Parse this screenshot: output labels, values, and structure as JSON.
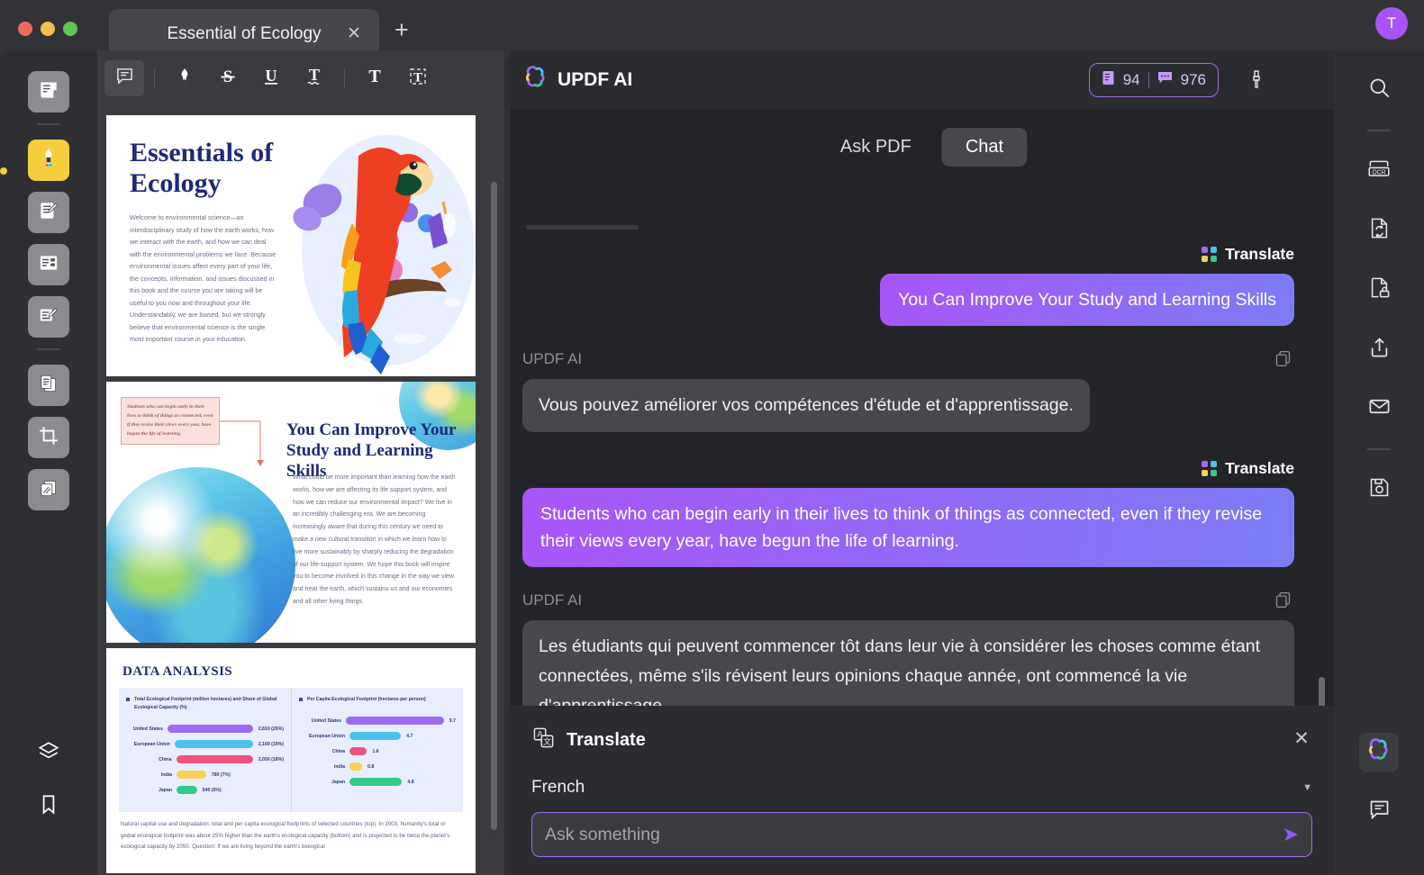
{
  "window": {
    "tab_title": "Essential of Ecology",
    "close_icon": "close-icon",
    "new_tab_icon": "plus-icon",
    "avatar_initial": "T"
  },
  "doc_toolbar": {
    "items": [
      {
        "name": "comment-tool",
        "icon": "comment-icon",
        "selected": true
      },
      {
        "name": "highlight-tool",
        "icon": "highlighter-icon",
        "selected": false
      },
      {
        "name": "strikethrough-tool",
        "icon": "strikethrough-icon",
        "selected": false
      },
      {
        "name": "underline-tool",
        "icon": "underline-icon",
        "selected": false
      },
      {
        "name": "squiggly-tool",
        "icon": "squiggly-underline-icon",
        "selected": false
      },
      {
        "name": "text-tool",
        "icon": "text-icon",
        "selected": false
      },
      {
        "name": "textbox-tool",
        "icon": "text-box-icon",
        "selected": false
      }
    ]
  },
  "left_rail": {
    "items": [
      {
        "name": "sidebar-item-reader",
        "icon": "book-reader-icon",
        "active": false
      },
      {
        "name": "sidebar-item-highlighter",
        "icon": "highlighter-icon",
        "active": true
      },
      {
        "name": "sidebar-item-edit",
        "icon": "edit-document-icon",
        "active": false
      },
      {
        "name": "sidebar-item-forms",
        "icon": "form-fields-icon",
        "active": false
      },
      {
        "name": "sidebar-item-sign",
        "icon": "signature-icon",
        "active": false
      },
      {
        "name": "sidebar-item-organize",
        "icon": "organize-pages-icon",
        "active": false
      },
      {
        "name": "sidebar-item-crop",
        "icon": "crop-icon",
        "active": false
      },
      {
        "name": "sidebar-item-compare",
        "icon": "compare-documents-icon",
        "active": false
      }
    ],
    "bottom": [
      {
        "name": "sidebar-item-layers",
        "icon": "layers-icon"
      },
      {
        "name": "sidebar-item-bookmarks",
        "icon": "bookmark-icon"
      }
    ]
  },
  "right_rail": {
    "items": [
      {
        "name": "search-button",
        "icon": "search-icon"
      },
      {
        "name": "ocr-button",
        "icon": "ocr-icon"
      },
      {
        "name": "convert-button",
        "icon": "convert-file-icon"
      },
      {
        "name": "protect-button",
        "icon": "document-lock-icon"
      },
      {
        "name": "share-button",
        "icon": "share-icon"
      },
      {
        "name": "email-button",
        "icon": "mail-icon"
      },
      {
        "name": "save-button",
        "icon": "floppy-save-icon"
      }
    ],
    "bottom": [
      {
        "name": "updf-ai-button",
        "icon": "updf-ai-logo-icon",
        "active": true
      },
      {
        "name": "comments-button",
        "icon": "comment-icon",
        "active": false
      }
    ]
  },
  "ai": {
    "title": "UPDF AI",
    "logo_icon": "updf-ai-logo-icon",
    "badge": {
      "pages_icon": "document-pages-icon",
      "pages_count": "94",
      "chats_icon": "chat-bubble-icon",
      "chats_count": "976"
    },
    "brush_icon": "brush-icon",
    "tabs": [
      {
        "label": "Ask PDF",
        "active": false
      },
      {
        "label": "Chat",
        "active": true
      }
    ],
    "messages": [
      {
        "action_label": "Translate",
        "action_icon": "translate-dots-icon",
        "user_text": "You Can Improve Your Study and Learning Skills",
        "assistant_name": "UPDF AI",
        "copy_icon": "copy-icon",
        "assistant_text": "Vous pouvez améliorer vos compétences d'étude et d'apprentissage."
      },
      {
        "action_label": "Translate",
        "action_icon": "translate-dots-icon",
        "user_text": "Students who can begin early in their lives to think of things as connected, even if they revise their views every year, have begun the life of learning.",
        "assistant_name": "UPDF AI",
        "copy_icon": "copy-icon",
        "assistant_text": "Les étudiants qui peuvent commencer tôt dans leur vie à considérer les choses comme étant connectées, même s'ils révisent leurs opinions chaque année, ont commencé la vie d'apprentissage."
      }
    ],
    "composer": {
      "mode_icon": "translate-language-icon",
      "mode_label": "Translate",
      "close_icon": "close-icon",
      "language_value": "French",
      "language_caret_icon": "chevron-down-icon",
      "input_placeholder": "Ask something",
      "input_value": "",
      "send_icon": "send-icon"
    }
  },
  "pdf": {
    "page1": {
      "title": "Essentials\nof Ecology",
      "body": "Welcome to environmental science—an interdisciplinary study of how the earth works, how we interact with the earth, and how we can deal with the environmental problems we face. Because environmental issues affect every part of your life, the concepts, information, and issues discussed in this book and the course you are taking will be useful to you now and throughout your life. Understandably, we are biased, but we strongly believe that environmental science is the single most important course in your education.",
      "artwork": "macaw-parrot-illustration"
    },
    "page2": {
      "note": "Students who can begin early in their lives to think of things as connected, even if they revise their views every year, have begun the life of learning.",
      "title": "You Can Improve Your\nStudy and Learning Skills",
      "body": "What could be more important than learning how the earth works, how we are affecting its life support system, and how we can reduce our environmental impact? We live in an incredibly challenging era. We are becoming increasingly aware that during this century we need to make a new cultural transition in which we learn how to live more sustainably by sharply reducing the degradation of our life-support system. We hope this book will inspire you to become involved in this change in the way we view and treat the earth, which sustains us and our economies and all other living things.",
      "artwork": "watercolor-earth-globe"
    },
    "page3": {
      "title": "DATA ANALYSIS",
      "caption": "Natural capital use and degradation: total and per capita ecological footprints of selected countries (top). In 2003, humanity's total or global ecological footprint was about 25% higher than the earth's ecological capacity (bottom) and is projected to be twice the planet's ecological capacity by 2050. Question: If we are living beyond the earth's biological"
    }
  },
  "chart_data": [
    {
      "type": "bar",
      "orientation": "horizontal",
      "title": "Total Ecological Footprint (million hectares) and Share of Global Ecological Capacity (%)",
      "categories": [
        "United States",
        "European Union",
        "China",
        "India",
        "Japan"
      ],
      "values": [
        2810,
        2160,
        2050,
        780,
        540
      ],
      "value_labels": [
        "2,810 (25%)",
        "2,160 (19%)",
        "2,050 (18%)",
        "780 (7%)",
        "540 (5%)"
      ],
      "shares_pct": [
        25,
        19,
        18,
        7,
        5
      ],
      "colors": [
        "#9b6bf0",
        "#49c2ef",
        "#f0527e",
        "#fbcf58",
        "#35c98a"
      ],
      "xlabel": "",
      "ylabel": "",
      "xlim": [
        0,
        2810
      ],
      "grid": false,
      "legend": "top"
    },
    {
      "type": "bar",
      "orientation": "horizontal",
      "title": "Per Capita Ecological Footprint (hectares per person)",
      "categories": [
        "United States",
        "European Union",
        "China",
        "India",
        "Japan"
      ],
      "values": [
        9.7,
        4.7,
        1.6,
        0.8,
        4.8
      ],
      "value_labels": [
        "9.7",
        "4.7",
        "1.6",
        "0.8",
        "4.8"
      ],
      "colors": [
        "#9b6bf0",
        "#49c2ef",
        "#f0527e",
        "#fbcf58",
        "#35c98a"
      ],
      "xlabel": "",
      "ylabel": "",
      "xlim": [
        0,
        9.7
      ],
      "grid": false,
      "legend": "top"
    }
  ]
}
